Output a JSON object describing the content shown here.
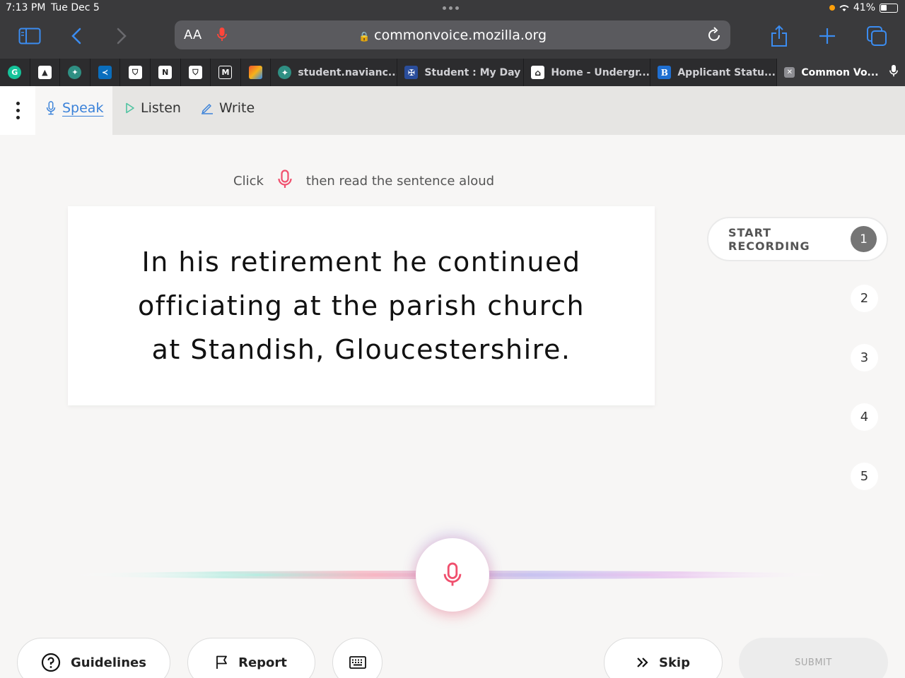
{
  "status_bar": {
    "time": "7:13 PM",
    "date": "Tue Dec 5",
    "battery": "41%"
  },
  "browser": {
    "text_size_label": "AA",
    "url": "commonvoice.mozilla.org",
    "pinned_tabs": [
      {
        "icon": "grammarly-icon",
        "color": "#15c39a",
        "glyph": "G"
      },
      {
        "icon": "graduation-cap-icon",
        "color": "#2c2c2e",
        "glyph": "🎓"
      },
      {
        "icon": "naviance-icon",
        "color": "#2f8f83",
        "glyph": "✦"
      },
      {
        "icon": "app-icon",
        "color": "#0a6ebd",
        "glyph": "⚡"
      },
      {
        "icon": "shield-icon",
        "color": "#ffffff",
        "glyph": "⛉"
      },
      {
        "icon": "notion-icon",
        "color": "#ffffff",
        "glyph": "N"
      },
      {
        "icon": "shield-icon",
        "color": "#ffffff",
        "glyph": "⛉"
      },
      {
        "icon": "m-icon",
        "color": "#2c2c2e",
        "glyph": "M"
      },
      {
        "icon": "colorful-icon",
        "color": "#f0542d",
        "glyph": "⚑"
      }
    ],
    "tabs": [
      {
        "label": "student.navianc...",
        "icon": "naviance-icon",
        "color": "#2f8f83",
        "glyph": "✦"
      },
      {
        "label": "Student : My Day",
        "icon": "school-crest-icon",
        "color": "#2a4d9b",
        "glyph": "✠"
      },
      {
        "label": "Home - Undergr...",
        "icon": "home-icon",
        "color": "#ffffff",
        "glyph": "⌂"
      },
      {
        "label": "Applicant Statu...",
        "icon": "b-icon",
        "color": "#1f6fd1",
        "glyph": "B"
      },
      {
        "label": "Common Vo...",
        "icon": "close-icon",
        "color": "#8e8e93",
        "glyph": "✕",
        "active": true
      }
    ]
  },
  "nav": {
    "speak": "Speak",
    "listen": "Listen",
    "write": "Write"
  },
  "instruction": {
    "before": "Click",
    "after": "then read the sentence aloud"
  },
  "sentence": "In his retirement he continued officiating at the parish church at Standish, Gloucestershire.",
  "recording": {
    "start_label": "START RECORDING",
    "steps": [
      "1",
      "2",
      "3",
      "4",
      "5"
    ]
  },
  "footer": {
    "guidelines": "Guidelines",
    "report": "Report",
    "skip": "Skip",
    "submit": "SUBMIT"
  },
  "colors": {
    "accent": "#3b82d9",
    "mic_red": "#f0506e",
    "listen_green": "#4fc3a1"
  }
}
